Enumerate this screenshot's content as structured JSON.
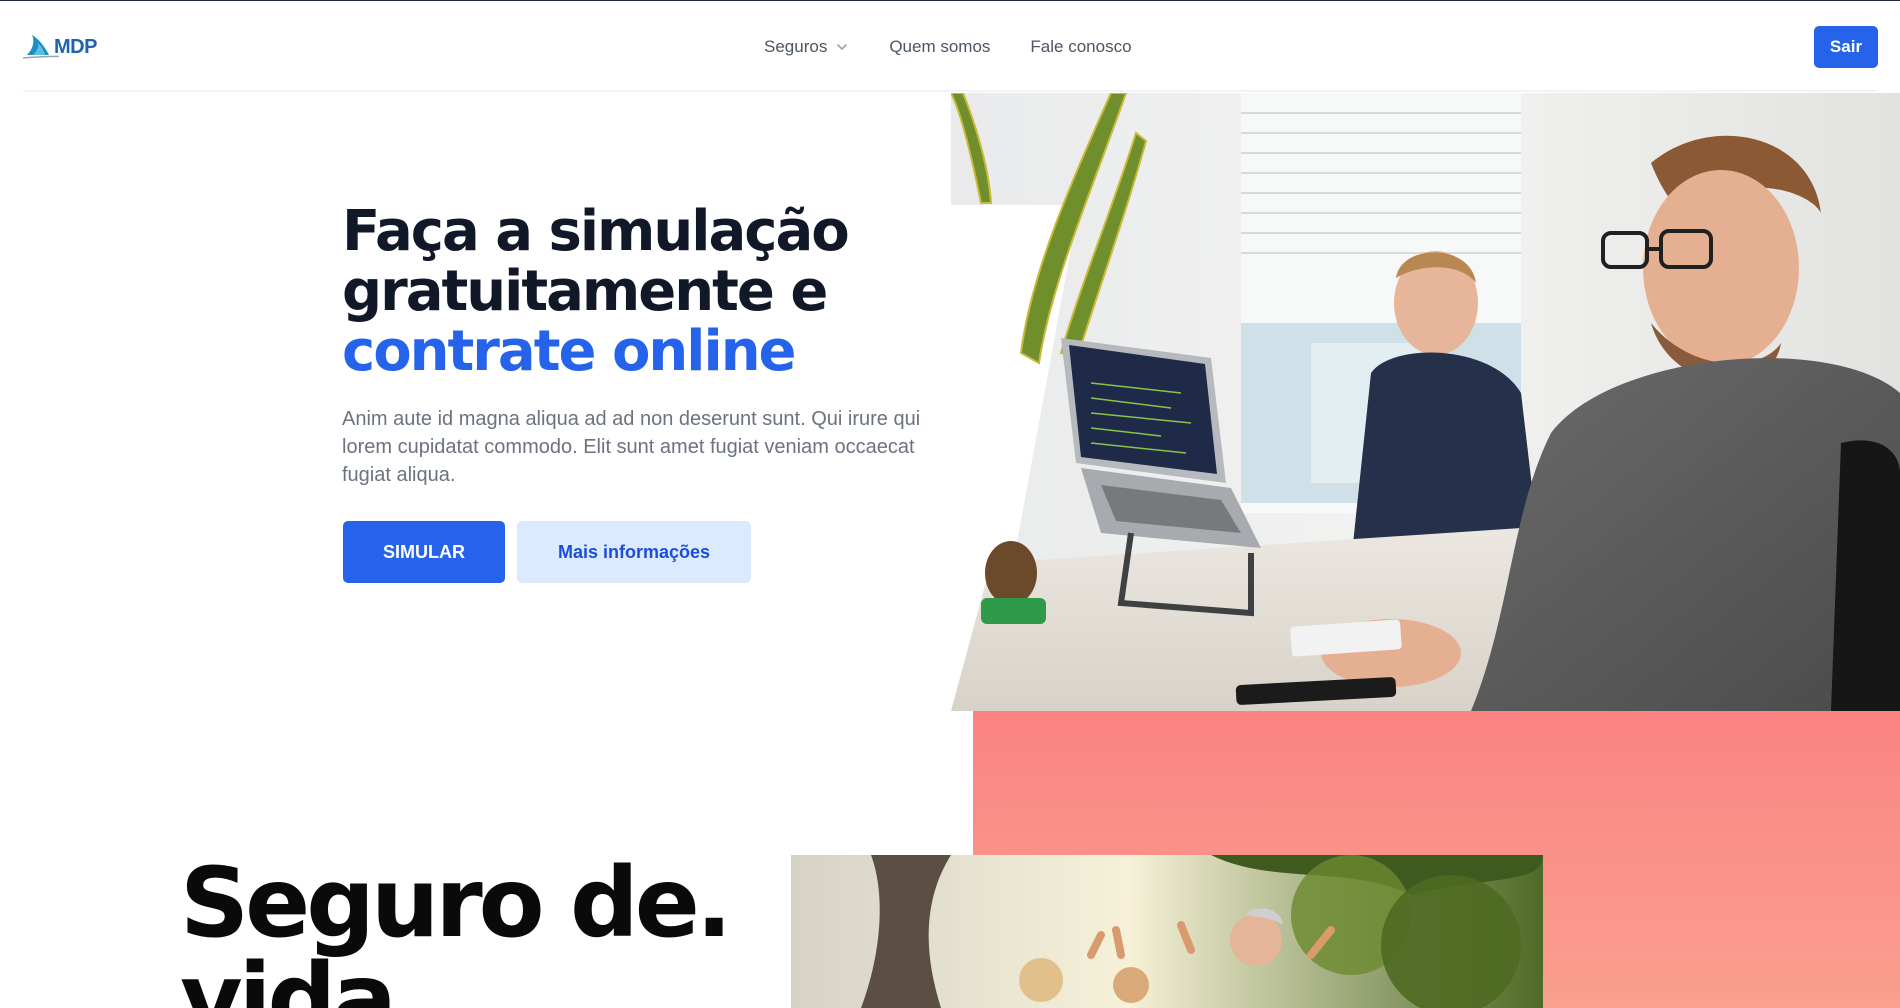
{
  "header": {
    "logo_text": "MDP",
    "nav": [
      {
        "label": "Seguros",
        "has_dropdown": true
      },
      {
        "label": "Quem somos",
        "has_dropdown": false
      },
      {
        "label": "Fale conosco",
        "has_dropdown": false
      }
    ],
    "sair_label": "Sair"
  },
  "hero": {
    "title_line1": "Faça a simulação",
    "title_line2": "gratuitamente e",
    "title_accent": "contrate online",
    "description": "Anim aute id magna aliqua ad ad non deserunt sunt. Qui irure qui lorem cupidatat commodo. Elit sunt amet fugiat veniam occaecat fugiat aliqua.",
    "primary_button": "SIMULAR",
    "secondary_button": "Mais informações"
  },
  "section2": {
    "title": "Seguro de. vida"
  },
  "colors": {
    "accent": "#2563eb",
    "accent_light": "#dbeafe",
    "pink": "#fb8383",
    "text_dark": "#111827",
    "text_muted": "#6b7280"
  },
  "icons": {
    "logo": "shark-fin-logo-icon",
    "dropdown": "chevron-down-icon"
  }
}
